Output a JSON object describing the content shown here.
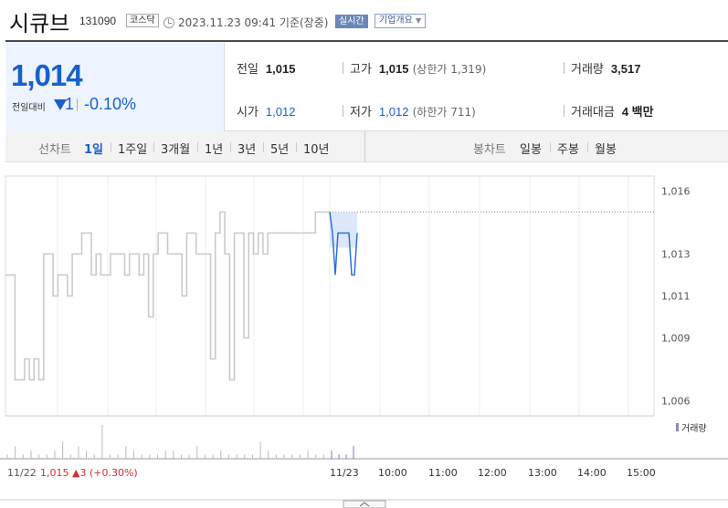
{
  "header": {
    "stock_name": "시큐브",
    "stock_code": "131090",
    "market": "코스닥",
    "timestamp": "2023.11.23 09:41 기준(장중)",
    "realtime_label": "실시간",
    "company_label": "기업개요"
  },
  "price": {
    "current": "1,014",
    "diff_label": "전일대비",
    "diff_value": "1",
    "diff_pct": "-0.10%",
    "direction": "down"
  },
  "stats": {
    "prev_close_label": "전일",
    "prev_close": "1,015",
    "high_label": "고가",
    "high": "1,015",
    "upper_limit": "(상한가 1,319)",
    "volume_label": "거래량",
    "volume": "3,517",
    "open_label": "시가",
    "open": "1,012",
    "low_label": "저가",
    "low": "1,012",
    "lower_limit": "(하한가 711)",
    "amount_label": "거래대금",
    "amount": "4 백만"
  },
  "tabs": {
    "line_label": "선차트",
    "line_tabs": [
      "1일",
      "1주일",
      "3개월",
      "1년",
      "3년",
      "5년",
      "10년"
    ],
    "active_line_tab": "1일",
    "candle_label": "봉차트",
    "candle_tabs": [
      "일봉",
      "주봉",
      "월봉"
    ]
  },
  "chart_data": {
    "type": "line",
    "y_ticks": [
      "1,016",
      "1,013",
      "1,011",
      "1,009",
      "1,006"
    ],
    "x_ticks": [
      "11/23",
      "10:00",
      "11:00",
      "12:00",
      "13:00",
      "14:00",
      "15:00"
    ],
    "prev_day_label": "11/22",
    "prev_day_summary": "1,015 ▲3 (+0.30%)",
    "volume_legend": "거래량",
    "ylim": [
      1005.5,
      1016.5
    ],
    "prev_close_line": 1015,
    "prev_day_series": [
      1012,
      1012,
      1007,
      1007,
      1008,
      1007,
      1008,
      1007,
      1013,
      1013,
      1011,
      1012,
      1012,
      1011,
      1013,
      1013,
      1014,
      1014,
      1012,
      1013,
      1012,
      1012,
      1013,
      1013,
      1013,
      1012,
      1013,
      1013,
      1012,
      1013,
      1010,
      1013,
      1014,
      1014,
      1013,
      1013,
      1013,
      1011,
      1014,
      1014,
      1013,
      1013,
      1013,
      1008,
      1014,
      1015,
      1013,
      1007,
      1014,
      1014,
      1009,
      1014,
      1013,
      1014,
      1013,
      1014,
      1014,
      1014,
      1014,
      1014,
      1014,
      1014,
      1014,
      1014,
      1014,
      1015,
      1015,
      1015,
      1015
    ],
    "today_series": [
      1015,
      1014,
      1012,
      1014,
      1014,
      1014,
      1014,
      1014,
      1012,
      1012,
      1014
    ],
    "prev_day_volume": [
      1,
      3,
      1,
      2,
      1,
      1,
      2,
      4,
      1,
      3,
      2,
      1,
      8,
      1,
      1,
      3,
      2,
      1,
      1,
      1,
      2,
      2,
      1,
      1,
      3,
      1,
      1,
      2,
      1,
      1,
      1,
      1,
      4,
      2,
      1,
      1,
      1,
      1,
      2,
      1,
      1
    ],
    "today_volume": [
      2,
      1,
      1,
      3
    ]
  }
}
